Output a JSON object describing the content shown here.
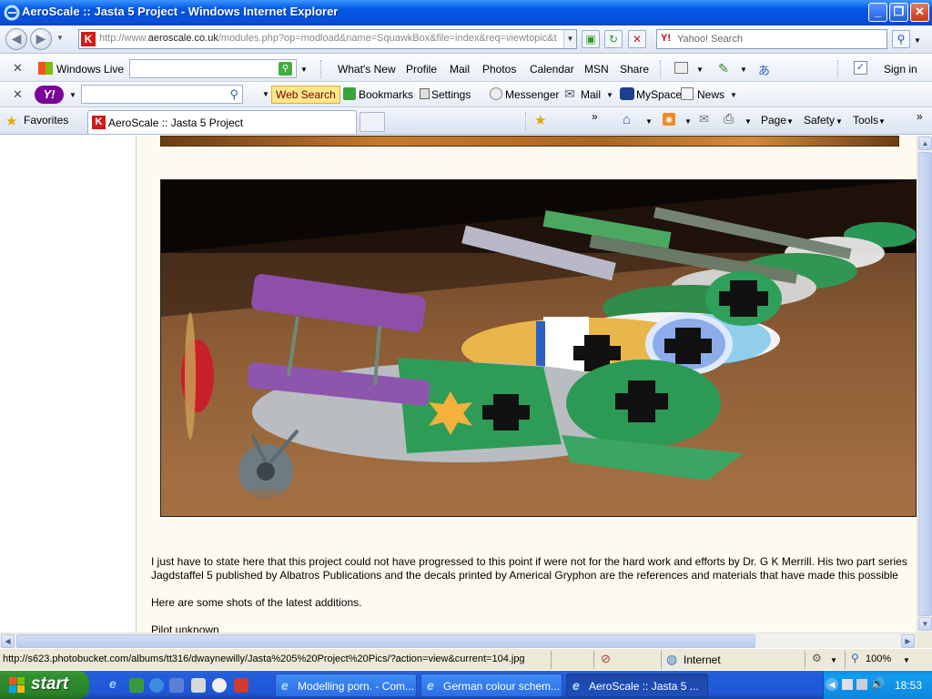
{
  "window": {
    "title": "AeroScale :: Jasta 5 Project - Windows Internet Explorer",
    "minimize": "_",
    "restore": "❐",
    "close": "✕"
  },
  "address": {
    "url_prefix": "http://www.",
    "url_domain": "aeroscale.co.uk",
    "url_rest": "/modules.php?op=modload&name=SquawkBox&file=index&req=viewtopic&t",
    "favicon": "K",
    "search_placeholder": "Yahoo! Search"
  },
  "live_toolbar": {
    "brand": "Windows Live",
    "links": [
      "What's New",
      "Profile",
      "Mail",
      "Photos",
      "Calendar",
      "MSN",
      "Share"
    ],
    "sign_in": "Sign in"
  },
  "yahoo_toolbar": {
    "logo": "Y!",
    "web_search": "Web Search",
    "bookmarks": "Bookmarks",
    "settings": "Settings",
    "messenger": "Messenger",
    "mail": "Mail",
    "myspace": "MySpace",
    "news": "News"
  },
  "tabs_bar": {
    "favorites": "Favorites",
    "active_tab": "AeroScale :: Jasta 5 Project",
    "page": "Page",
    "safety": "Safety",
    "tools": "Tools"
  },
  "content": {
    "paragraph1_line1": "I just have to state here that this project could not have progressed to this point if were not for the hard work and efforts by Dr. G K Merrill. His two part series",
    "paragraph1_line2": "Jagdstaffel 5 published by Albatros Publications and the decals printed by Americal Gryphon are the references and materials that have made this possible",
    "paragraph2": "Here are some shots of the latest additions.",
    "paragraph3": "Pilot unknown"
  },
  "status": {
    "url": "http://s623.photobucket.com/albums/tt316/dwaynewilly/Jasta%205%20Project%20Pics/?action=view&current=104.jpg",
    "zone": "Internet",
    "zoom": "100%"
  },
  "taskbar": {
    "start": "start",
    "tasks": [
      "Modelling porn. - Com...",
      "German colour schem...",
      "AeroScale :: Jasta 5 ..."
    ],
    "clock": "18:53"
  },
  "colors": {
    "xp_blue": "#0058e6",
    "start_green": "#2f8f2f",
    "yahoo_purple": "#7b0099"
  }
}
